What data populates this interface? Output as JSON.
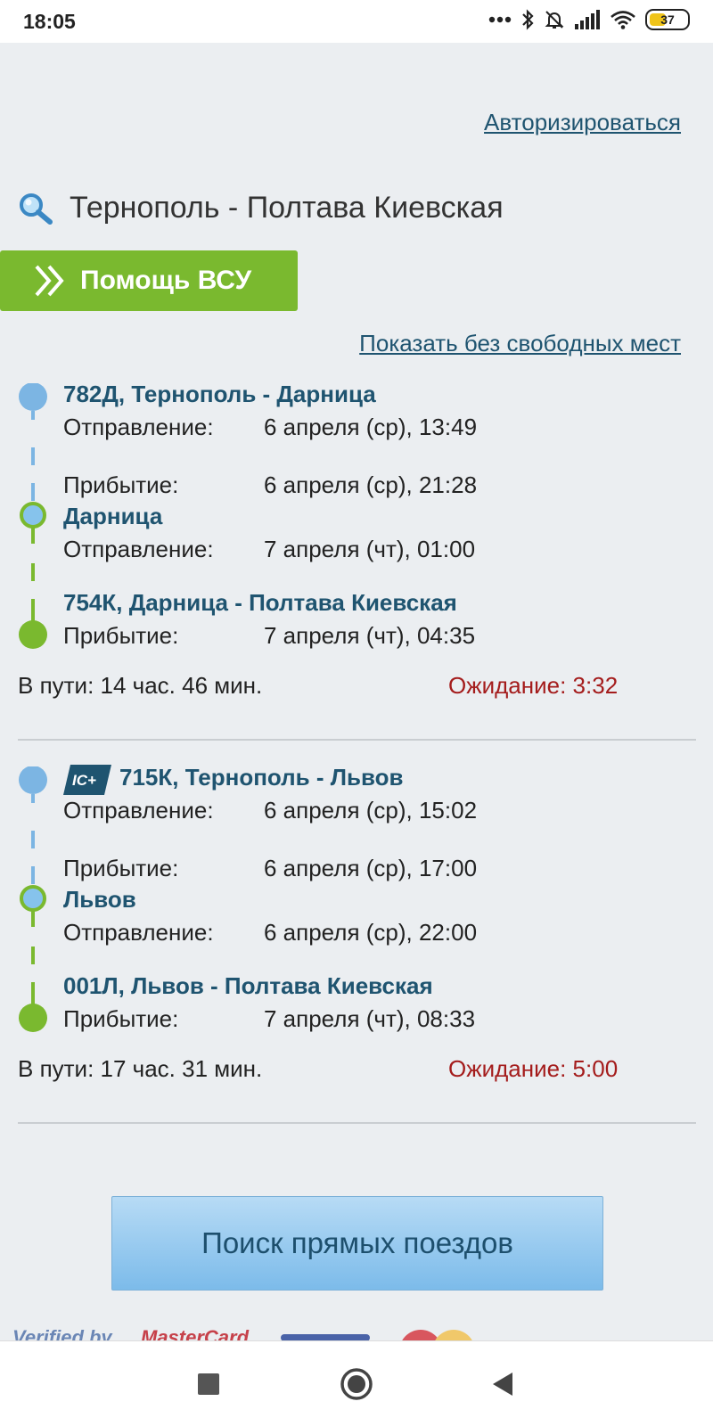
{
  "status_bar": {
    "time": "18:05",
    "battery": "37",
    "icons": [
      "dots-icon",
      "bluetooth-icon",
      "mute-bell-icon",
      "signal-icon",
      "wifi-icon",
      "battery-icon"
    ]
  },
  "header": {
    "auth_link": "Авторизироваться"
  },
  "route": {
    "icon": "search-icon",
    "title": "Тернополь - Полтава Киевская"
  },
  "help_button": {
    "icon": "double-chevron-icon",
    "label": "Помощь ВСУ"
  },
  "show_link": "Показать без свободных мест",
  "labels": {
    "departure": "Отправление:",
    "arrival": "Прибытие:"
  },
  "trips": [
    {
      "badge": "",
      "train1": "782Д, Тернополь - Дарница",
      "departure": "6 апреля (ср), 13:49",
      "arrival1": "6 апреля (ср), 21:28",
      "transfer_station": "Дарница",
      "departure2": "7 апреля (чт), 01:00",
      "train2": "754К, Дарница - Полтава Киевская",
      "arrival2": "7 апреля (чт), 04:35",
      "duration": "В пути: 14 час. 46 мин.",
      "wait": "Ожидание: 3:32"
    },
    {
      "badge": "IC+",
      "train1": "715К, Тернополь - Львов",
      "departure": "6 апреля (ср), 15:02",
      "arrival1": "6 апреля (ср), 17:00",
      "transfer_station": "Львов",
      "departure2": "6 апреля (ср), 22:00",
      "train2": "001Л, Львов - Полтава Киевская",
      "arrival2": "7 апреля (чт), 08:33",
      "duration": "В пути: 17 час. 31 мин.",
      "wait": "Ожидание: 5:00"
    }
  ],
  "search_button": "Поиск прямых поездов",
  "payment": {
    "verified": "Verified by",
    "mastercard": "MasterCard"
  },
  "nav_bar": {
    "icons": [
      "recent-apps-icon",
      "home-icon",
      "back-icon"
    ]
  }
}
